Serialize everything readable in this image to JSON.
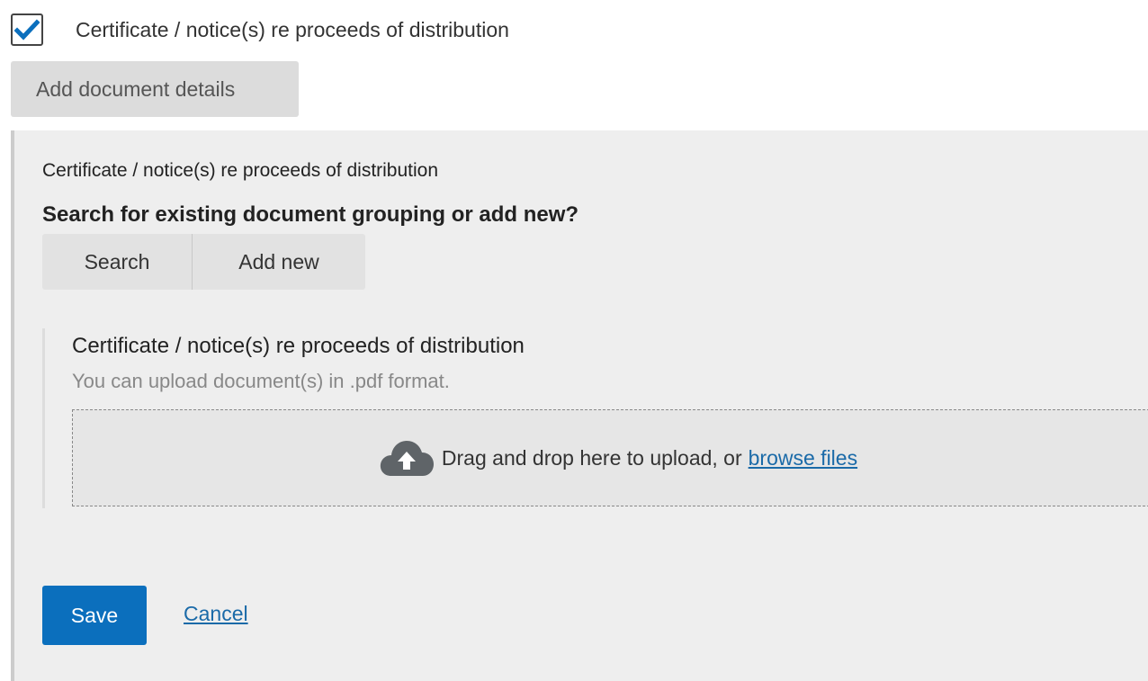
{
  "document_type": {
    "checked": true,
    "label": "Certificate / notice(s) re proceeds of distribution"
  },
  "add_details_button": {
    "label": "Add document details"
  },
  "panel": {
    "title": "Certificate / notice(s) re proceeds of distribution",
    "question": "Search for existing document grouping or add new?",
    "options": [
      {
        "label": "Search"
      },
      {
        "label": "Add new"
      }
    ],
    "upload": {
      "title": "Certificate / notice(s) re proceeds of distribution",
      "hint": "You can upload document(s) in .pdf format.",
      "drop_text": "Drag and drop here to upload, or",
      "browse_label": "browse files",
      "icon": "cloud-upload-icon"
    },
    "save_label": "Save",
    "cancel_label": "Cancel"
  },
  "colors": {
    "primary": "#0b6fbd",
    "link": "#1a6aa8",
    "panel_bg": "#eeeeee",
    "checkmark": "#0b6fbd"
  }
}
